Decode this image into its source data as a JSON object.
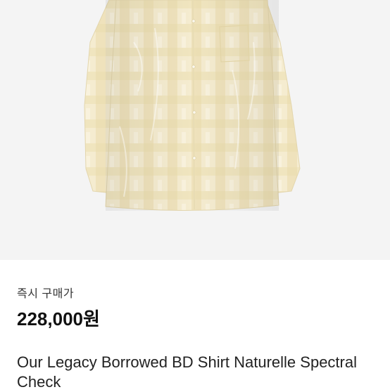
{
  "product": {
    "image_alt": "product-photo",
    "label": "즉시 구매가",
    "price": "228,000원",
    "title": "Our Legacy Borrowed BD Shirt Naturelle Spectral Check"
  },
  "colors": {
    "background": "#f4f4f4",
    "shirt_base": "#f3e9c9",
    "shirt_check": "#e6d39a"
  }
}
